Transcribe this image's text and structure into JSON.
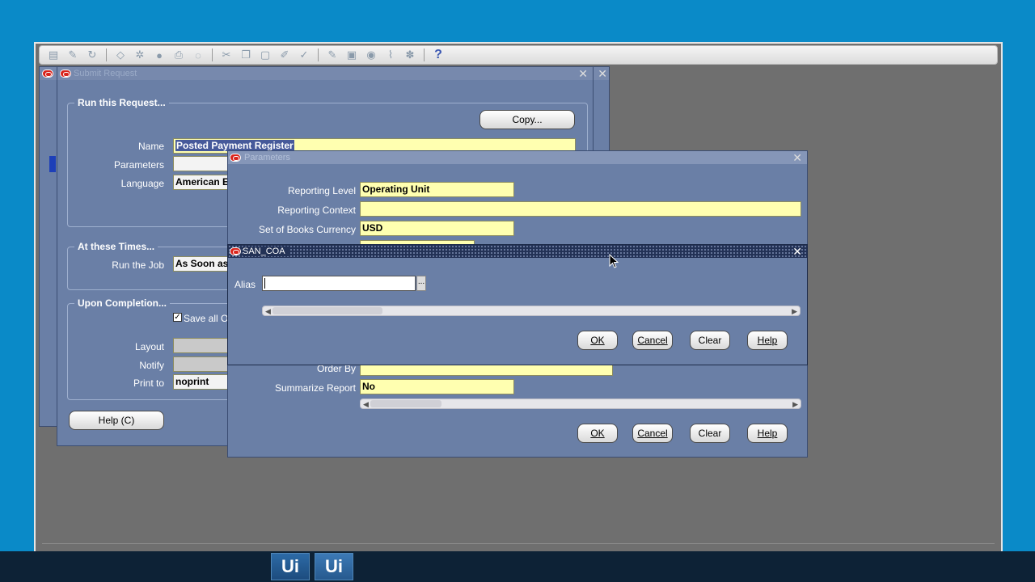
{
  "toolbar": {
    "icons": [
      "new-icon",
      "find-icon",
      "navigate-icon",
      "zoom-icon",
      "save-icon",
      "next-step-icon",
      "print-icon",
      "close-form-icon",
      "cut-icon",
      "copy-icon",
      "paste-icon",
      "clear-record-icon",
      "delete-icon",
      "edit-field-icon",
      "zoom-record-icon",
      "translations-icon",
      "attachments-icon",
      "folder-tools-icon"
    ],
    "help_glyph": "?"
  },
  "submit_request": {
    "title": "Submit Request",
    "run_group_title": "Run this Request...",
    "copy_button": "Copy...",
    "name_label": "Name",
    "name_value": "Posted Payment Register",
    "parameters_label": "Parameters",
    "parameters_value": "",
    "language_label": "Language",
    "language_value": "American E",
    "times_group_title": "At these Times...",
    "run_job_label": "Run the Job",
    "run_job_value": "As Soon as",
    "completion_group_title": "Upon Completion...",
    "save_all_label": "Save all O",
    "layout_label": "Layout",
    "notify_label": "Notify",
    "print_to_label": "Print to",
    "print_to_value": "noprint",
    "help_button": "Help (C)"
  },
  "parameters": {
    "title": "Parameters",
    "reporting_level_label": "Reporting Level",
    "reporting_level_value": "Operating Unit",
    "reporting_context_label": "Reporting Context",
    "reporting_context_value": "",
    "sob_currency_label": "Set of Books Currency",
    "sob_currency_value": "USD",
    "order_by_label": "Order By",
    "summarize_label": "Summarize Report",
    "summarize_value": "No",
    "ok": "OK",
    "cancel": "Cancel",
    "clear": "Clear",
    "help": "Help"
  },
  "san_coa": {
    "title": "SAN_COA",
    "alias_label": "Alias",
    "alias_value": "",
    "lov_button": "...",
    "ok": "OK",
    "cancel": "Cancel",
    "clear": "Clear",
    "help": "Help"
  },
  "taskbar": {
    "tile1": "Ui",
    "tile2": "Ui"
  },
  "colors": {
    "desktop": "#0a8ac8",
    "oracle_panel": "#6a7fa6",
    "required_field": "#ffffb0",
    "taskbar": "#0d2236"
  }
}
